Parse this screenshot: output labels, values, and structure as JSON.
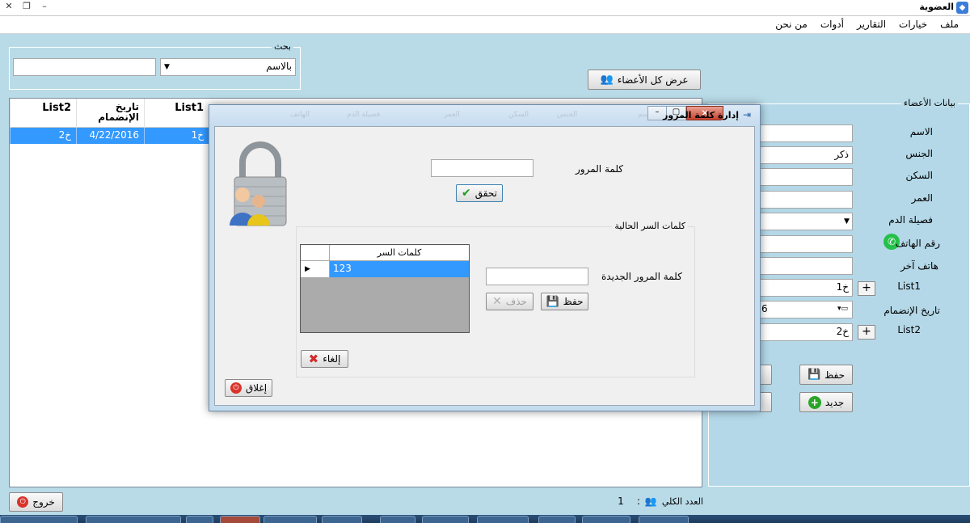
{
  "window": {
    "title": "العضوية"
  },
  "menu": [
    "ملف",
    "خيارات",
    "التقارير",
    "أدوات",
    "من نحن"
  ],
  "search": {
    "legend": "بحث",
    "by_value": "بالاسم",
    "text_value": ""
  },
  "show_all_button": "عرض كل الأعضاء",
  "grid": {
    "columns": [
      "List2",
      "تاريخ\nالإنضمام",
      "List1"
    ],
    "rows": [
      {
        "list2": "خ2",
        "join_date": "4/22/2016",
        "list1": "خ1"
      }
    ]
  },
  "members": {
    "legend": "بيانات الأعضاء",
    "labels": {
      "name": "الاسم",
      "gender": "الجنس",
      "residence": "السكن",
      "age": "العمر",
      "blood": "فصيلة الدم",
      "phone": "رقم الهاتف",
      "other_phone": "هاتف آخر",
      "list1": "List1",
      "join_date": "تاريخ الإنضمام",
      "list2": "List2"
    },
    "values": {
      "gender": "ذكر",
      "list1": "خ1",
      "list2": "خ2",
      "join_date_partial": "6"
    },
    "save_button": "حفظ",
    "new_button": "جديد"
  },
  "exit_button": "خروج",
  "status": {
    "total_label": "العدد الكلي",
    "separator": ":",
    "total_value": "1"
  },
  "dialog": {
    "title": "إدارة كلمة المرور",
    "password_label": "كلمة المرور",
    "verify_button": "تحقق",
    "current_passwords_legend": "كلمات السر الحالية",
    "passwords_column": "كلمات السر",
    "passwords": [
      "123"
    ],
    "new_password_label": "كلمة المرور الجديدة",
    "delete_button": "حذف",
    "save_button": "حفظ",
    "cancel_button": "إلغاء",
    "close_button": "إغلاق",
    "hidden_headers": [
      "الاسم",
      "الجنس",
      "السكن",
      "العمر",
      "فصيلة الدم",
      "الهاتف"
    ]
  }
}
